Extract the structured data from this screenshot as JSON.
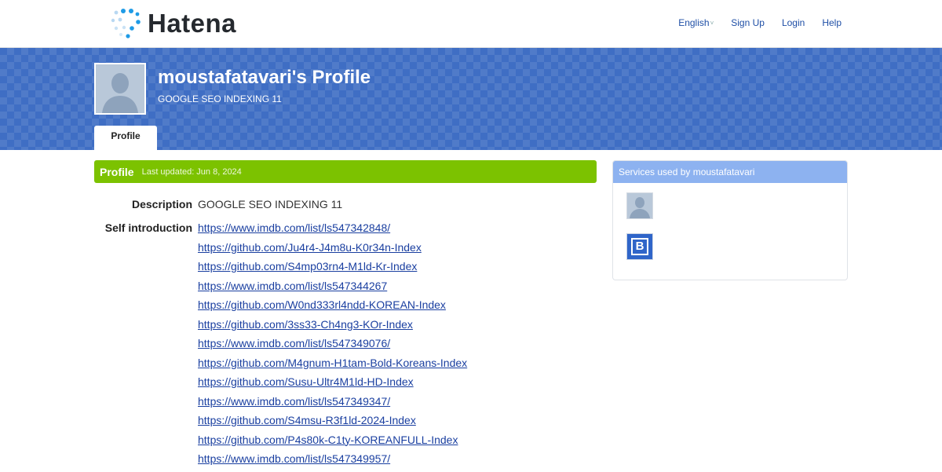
{
  "header": {
    "logo_text": "Hatena",
    "nav": {
      "language": "English",
      "language_caret": "˅",
      "signup": "Sign Up",
      "login": "Login",
      "help": "Help"
    }
  },
  "banner": {
    "title": "moustafatavari's Profile",
    "subtitle": "GOOGLE SEO INDEXING 11",
    "tab": "Profile"
  },
  "section": {
    "title": "Profile",
    "updated": "Last updated: Jun 8, 2024"
  },
  "fields": {
    "description_label": "Description",
    "description_value": "GOOGLE SEO INDEXING 11",
    "intro_label": "Self introduction"
  },
  "intro_links": [
    "https://www.imdb.com/list/ls547342848/",
    "https://github.com/Ju4r4-J4m8u-K0r34n-Index",
    "https://github.com/S4mp03rn4-M1ld-Kr-Index",
    "https://www.imdb.com/list/ls547344267",
    "https://github.com/W0nd333rl4ndd-KOREAN-Index",
    "https://github.com/3ss33-Ch4ng3-KOr-Index",
    "https://www.imdb.com/list/ls547349076/",
    "https://github.com/M4gnum-H1tam-Bold-Koreans-Index",
    "https://github.com/Susu-Ultr4M1ld-HD-Index",
    "https://www.imdb.com/list/ls547349347/",
    "https://github.com/S4msu-R3f1ld-2024-Index",
    "https://github.com/P4s80k-C1ty-KOREANFULL-Index",
    "https://www.imdb.com/list/ls547349957/"
  ],
  "sidebar": {
    "title": "Services used by moustafatavari",
    "bookmark_glyph": "B"
  },
  "colors": {
    "banner": "#3f6ec4",
    "section_bar": "#7cc200",
    "sidebar_head": "#8db2f0",
    "link": "#1a3fa0"
  }
}
